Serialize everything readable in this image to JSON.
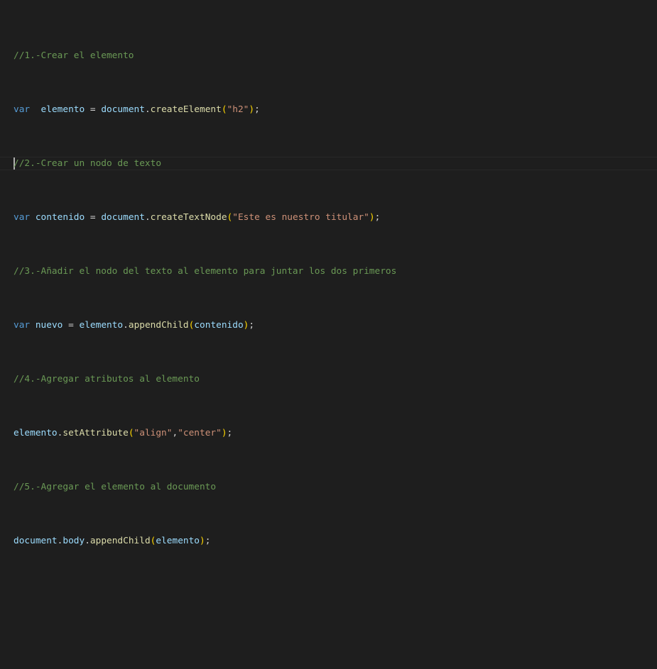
{
  "editor": {
    "lines": [
      {
        "comment": "//1.-Crear el elemento"
      },
      {
        "kw": "var",
        "gap": "  ",
        "name": "elemento",
        "eq": " = ",
        "obj": "document",
        "dot": ".",
        "fn": "createElement",
        "open": "(",
        "str": "\"h2\"",
        "close": ")",
        "end": ";"
      },
      {
        "comment": "//2.-Crear un nodo de texto"
      },
      {
        "kw": "var",
        "gap": " ",
        "name": "contenido",
        "eq": " = ",
        "obj": "document",
        "dot": ".",
        "fn": "createTextNode",
        "open": "(",
        "str": "\"Este es nuestro titular\"",
        "close": ")",
        "end": ";"
      },
      {
        "comment": "//3.-Añadir el nodo del texto al elemento para juntar los dos primeros"
      },
      {
        "kw": "var",
        "gap": " ",
        "name": "nuevo",
        "eq": " = ",
        "obj": "elemento",
        "dot": ".",
        "fn": "appendChild",
        "open": "(",
        "arg": "contenido",
        "close": ")",
        "end": ";"
      },
      {
        "comment": "//4.-Agregar atributos al elemento"
      },
      {
        "obj": "elemento",
        "dot": ".",
        "fn": "setAttribute",
        "open": "(",
        "str1": "\"align\"",
        "comma": ",",
        "str2": "\"center\"",
        "close": ")",
        "end": ";"
      },
      {
        "comment": "//5.-Agregar el elemento al documento"
      },
      {
        "obj": "document",
        "dot1": ".",
        "prop": "body",
        "dot2": ".",
        "fn": "appendChild",
        "open": "(",
        "arg": "elemento",
        "close": ")",
        "end": ";"
      }
    ]
  },
  "colors": {
    "background": "#1e1e1e",
    "comment": "#6a9955",
    "keyword": "#569cd6",
    "variable": "#9cdcfe",
    "function": "#dcdcaa",
    "string": "#ce9178",
    "bracket": "#ffd700",
    "cursor": "#aeafad"
  }
}
